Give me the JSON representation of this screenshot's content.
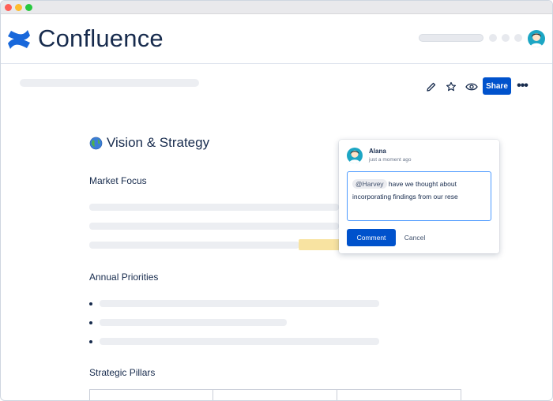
{
  "app": {
    "name": "Confluence",
    "logo_icon": "confluence-logo-icon",
    "accent": "#0052CC"
  },
  "toolbar": {
    "share_label": "Share",
    "more_label": "•••",
    "icons": [
      "edit-pencil-icon",
      "star-icon",
      "watch-eye-icon"
    ]
  },
  "page": {
    "title_icon": "globe-icon",
    "title": "Vision & Strategy",
    "sections": {
      "market_focus": "Market Focus",
      "annual_priorities": "Annual Priorities",
      "strategic_pillars": "Strategic Pillars"
    },
    "bullet_char": "•"
  },
  "comment": {
    "author": "Alana",
    "timestamp": "just a moment ago",
    "mention": "@Harvey",
    "text_line1": " have we thought about",
    "text_line2": "incorporating findings from our rese",
    "submit_label": "Comment",
    "cancel_label": "Cancel"
  }
}
